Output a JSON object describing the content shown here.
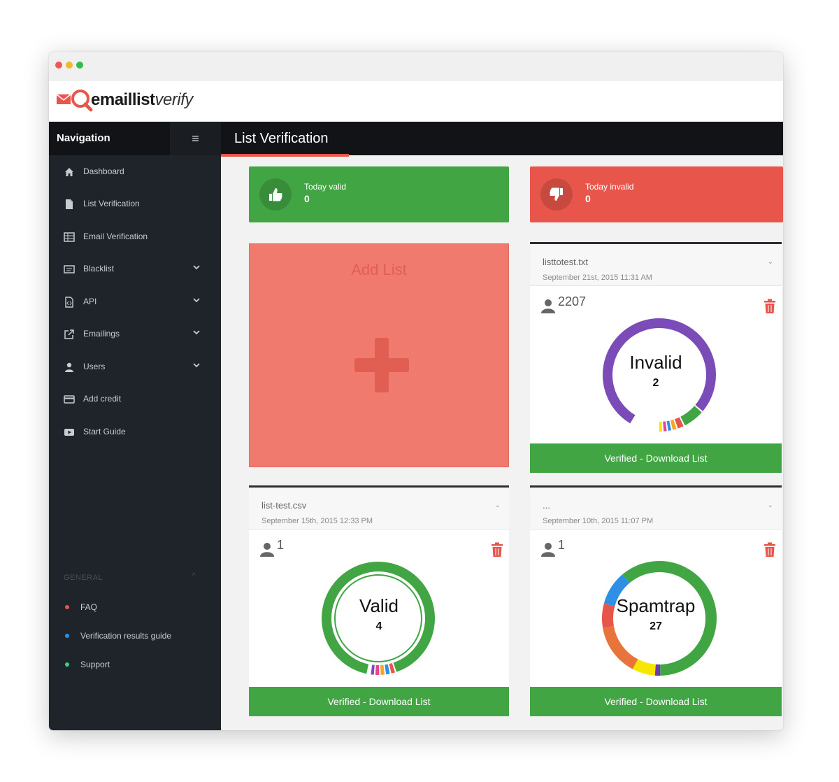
{
  "brand": {
    "part1": "emaillist",
    "part2": "verify"
  },
  "sidebar": {
    "heading": "Navigation",
    "menu_icon": "hamburger-icon",
    "items": [
      {
        "label": "Dashboard",
        "icon": "home-icon"
      },
      {
        "label": "List Verification",
        "icon": "file-icon"
      },
      {
        "label": "Email Verification",
        "icon": "table-icon"
      },
      {
        "label": "Blacklist",
        "icon": "list-box-icon",
        "expandable": true
      },
      {
        "label": "API",
        "icon": "code-file-icon",
        "expandable": true
      },
      {
        "label": "Emailings",
        "icon": "external-link-icon",
        "expandable": true
      },
      {
        "label": "Users",
        "icon": "user-icon",
        "expandable": true
      },
      {
        "label": "Add credit",
        "icon": "credit-card-icon"
      },
      {
        "label": "Start Guide",
        "icon": "video-icon"
      }
    ],
    "general_heading": "GENERAL",
    "general_items": [
      {
        "label": "FAQ",
        "color": "#e8564b"
      },
      {
        "label": "Verification results guide",
        "color": "#2d8fe6"
      },
      {
        "label": "Support",
        "color": "#3fd17a"
      }
    ]
  },
  "header": {
    "title": "List Verification"
  },
  "stats": {
    "valid": {
      "label": "Today valid",
      "value": "0",
      "icon": "thumbs-up-icon",
      "color": "#42a544"
    },
    "invalid": {
      "label": "Today invalid",
      "value": "0",
      "icon": "thumbs-down-icon",
      "color": "#e8564b"
    }
  },
  "add_list": {
    "label": "Add List",
    "icon": "plus-icon",
    "color": "#f07a6d"
  },
  "cards": [
    {
      "filename": "listtotest.txt",
      "date": "September 21st, 2015 11:31 AM",
      "count": "2207",
      "status": "Invalid",
      "status_count": "2",
      "button": "Verified - Download List",
      "primary_color": "#7b4bb8"
    },
    {
      "filename": "list-test.csv",
      "date": "September 15th, 2015 12:33 PM",
      "count": "1",
      "status": "Valid",
      "status_count": "4",
      "button": "Verified - Download List",
      "primary_color": "#42a544"
    },
    {
      "filename": "...",
      "date": "September 10th, 2015 11:07 PM",
      "count": "1",
      "status": "Spamtrap",
      "status_count": "27",
      "button": "Verified - Download List",
      "primary_color": "#42a544"
    }
  ],
  "colors": {
    "accent_red": "#e8564b",
    "accent_green": "#42a544",
    "sidebar_bg": "#1f232a"
  }
}
